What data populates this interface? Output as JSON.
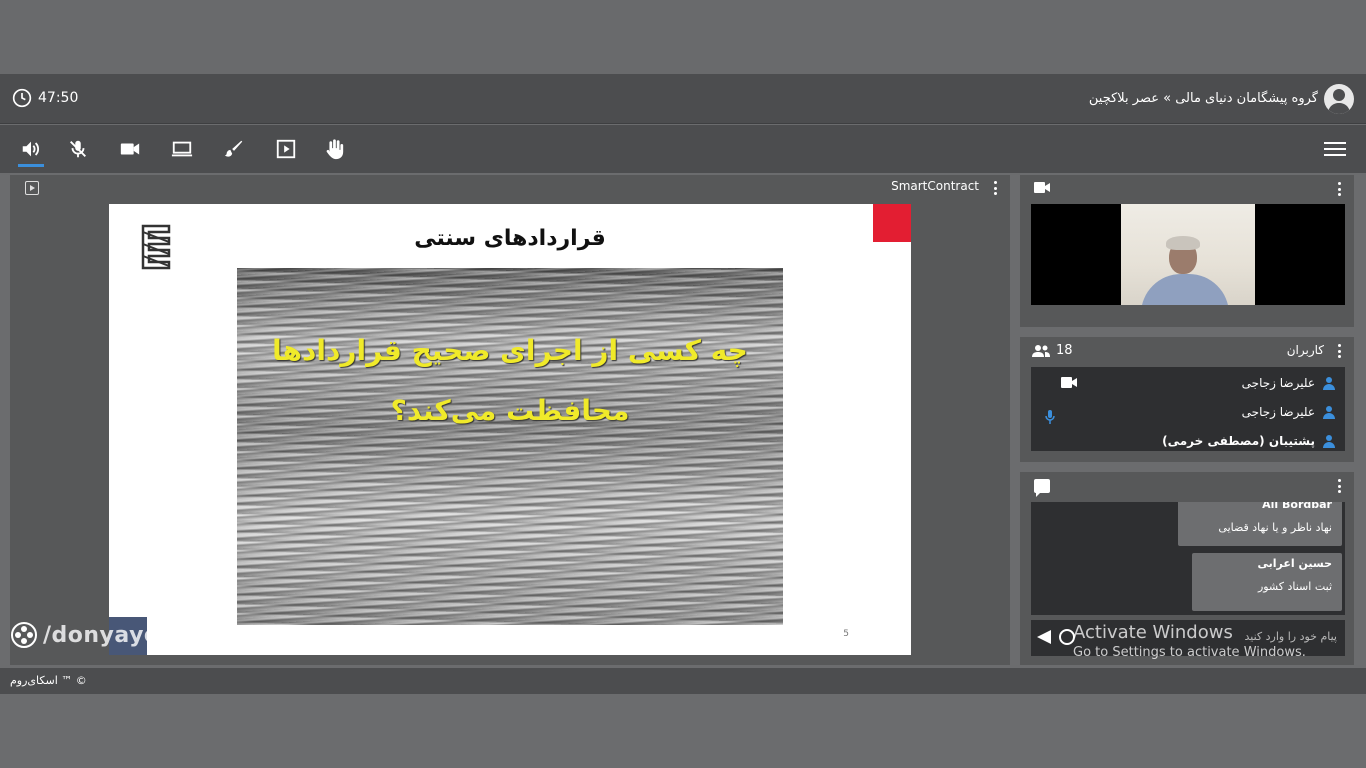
{
  "header": {
    "timer": "47:50",
    "title": "گروه پیشگامان دنیای مالی » عصر بلاکچین"
  },
  "toolbar": {
    "tools": [
      "speaker-icon",
      "mic-off-icon",
      "camera-icon",
      "screen-share-icon",
      "brush-icon",
      "presentation-icon",
      "raise-hand-icon"
    ]
  },
  "stage": {
    "document_name": "SmartContract",
    "slide": {
      "heading": "قراردادهای سنتی",
      "question_line1": "چه کسی از اجرای صحیح قراردادها",
      "question_line2": "محافظت می‌کند؟",
      "page_number": "5"
    }
  },
  "watermark": "/donyayemali",
  "users": {
    "label": "کاربران",
    "count": "18",
    "list": [
      {
        "name": "علیرضا زجاجی"
      },
      {
        "name": "علیرضا زجاجی"
      },
      {
        "name": "پشتیبان (مصطفی خرمی)"
      }
    ]
  },
  "chat": {
    "messages": [
      {
        "sender": "Ali Bordbar",
        "text": "نهاد ناظر و یا نهاد قضایی"
      },
      {
        "sender": "حسین اعرابی",
        "text": "ثبت اسناد کشور"
      }
    ],
    "placeholder": "پیام خود را وارد کنید"
  },
  "activation": {
    "title": "Activate Windows",
    "subtitle": "Go to Settings to activate Windows."
  },
  "footer": {
    "brand": "اسکای‌روم ™ ©"
  },
  "colors": {
    "accent": "#3b8fdc",
    "slide_question": "#f0ea2a",
    "slide_corner": "#e31e32"
  }
}
